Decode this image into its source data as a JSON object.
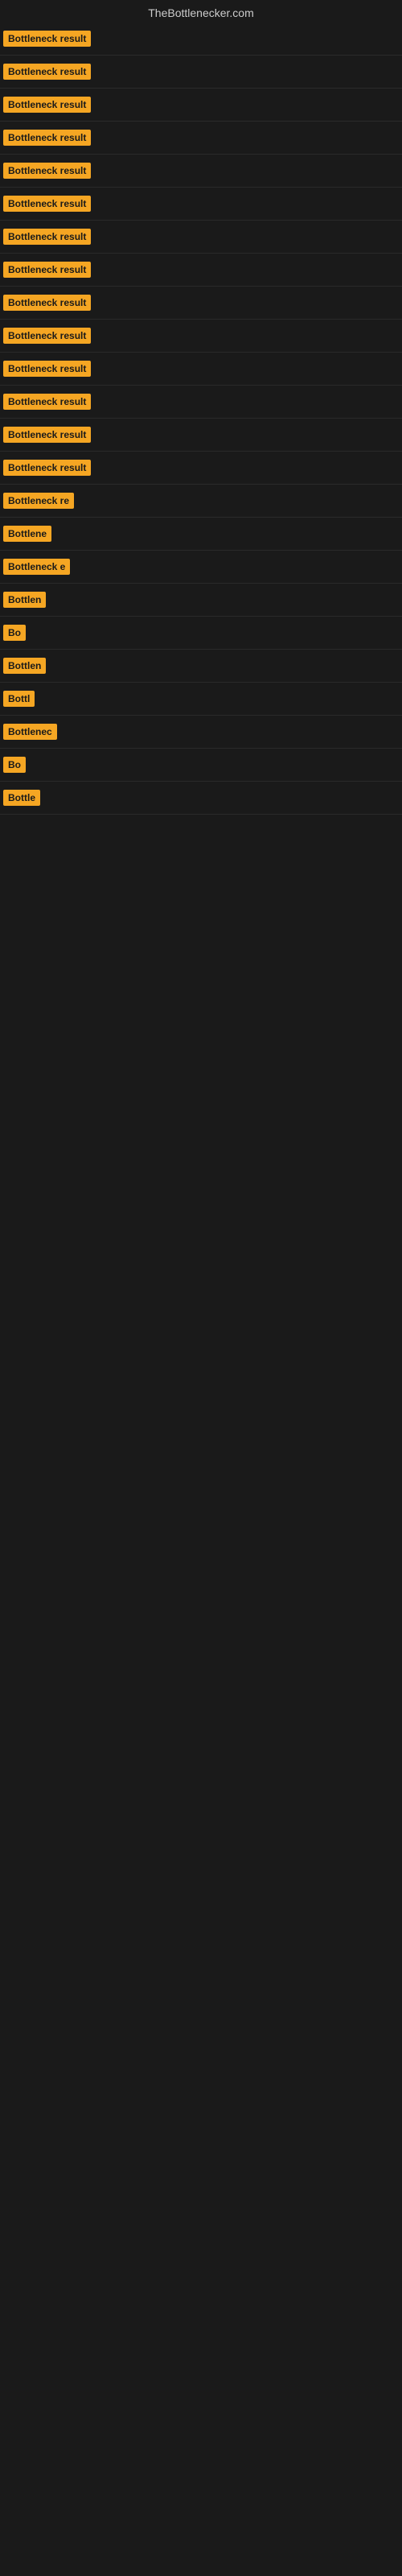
{
  "header": {
    "title": "TheBottlenecker.com"
  },
  "rows": [
    {
      "id": 1,
      "label": "Bottleneck result",
      "visible_chars": 16
    },
    {
      "id": 2,
      "label": "Bottleneck result",
      "visible_chars": 16
    },
    {
      "id": 3,
      "label": "Bottleneck result",
      "visible_chars": 16
    },
    {
      "id": 4,
      "label": "Bottleneck result",
      "visible_chars": 16
    },
    {
      "id": 5,
      "label": "Bottleneck result",
      "visible_chars": 16
    },
    {
      "id": 6,
      "label": "Bottleneck result",
      "visible_chars": 16
    },
    {
      "id": 7,
      "label": "Bottleneck result",
      "visible_chars": 16
    },
    {
      "id": 8,
      "label": "Bottleneck result",
      "visible_chars": 16
    },
    {
      "id": 9,
      "label": "Bottleneck result",
      "visible_chars": 16
    },
    {
      "id": 10,
      "label": "Bottleneck result",
      "visible_chars": 16
    },
    {
      "id": 11,
      "label": "Bottleneck result",
      "visible_chars": 16
    },
    {
      "id": 12,
      "label": "Bottleneck result",
      "visible_chars": 16
    },
    {
      "id": 13,
      "label": "Bottleneck result",
      "visible_chars": 16
    },
    {
      "id": 14,
      "label": "Bottleneck result",
      "visible_chars": 16
    },
    {
      "id": 15,
      "label": "Bottleneck re",
      "visible_chars": 13
    },
    {
      "id": 16,
      "label": "Bottlene",
      "visible_chars": 8
    },
    {
      "id": 17,
      "label": "Bottleneck e",
      "visible_chars": 12
    },
    {
      "id": 18,
      "label": "Bottlen",
      "visible_chars": 7
    },
    {
      "id": 19,
      "label": "Bo",
      "visible_chars": 2
    },
    {
      "id": 20,
      "label": "Bottlen",
      "visible_chars": 7
    },
    {
      "id": 21,
      "label": "Bottl",
      "visible_chars": 5
    },
    {
      "id": 22,
      "label": "Bottlenec",
      "visible_chars": 9
    },
    {
      "id": 23,
      "label": "Bo",
      "visible_chars": 2
    },
    {
      "id": 24,
      "label": "Bottle",
      "visible_chars": 6
    }
  ]
}
